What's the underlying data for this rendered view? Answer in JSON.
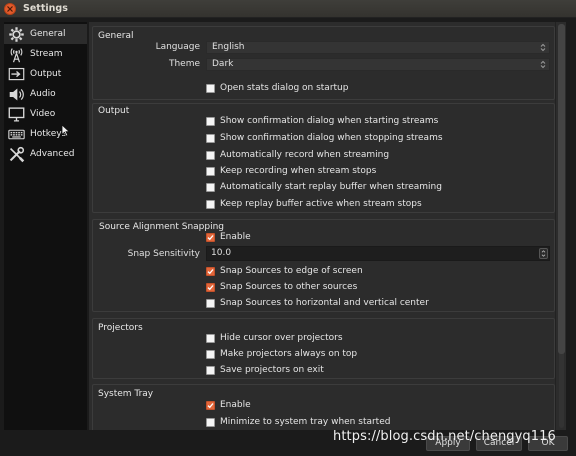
{
  "window": {
    "title": "Settings",
    "close_icon": "close-icon",
    "accent": "#e2663a"
  },
  "sidebar": {
    "items": [
      {
        "label": "General",
        "icon": "gear-icon",
        "active": true
      },
      {
        "label": "Stream",
        "icon": "broadcast-tower-icon"
      },
      {
        "label": "Output",
        "icon": "output-arrow-icon"
      },
      {
        "label": "Audio",
        "icon": "speaker-icon"
      },
      {
        "label": "Video",
        "icon": "monitor-icon"
      },
      {
        "label": "Hotkeys",
        "icon": "keyboard-icon"
      },
      {
        "label": "Advanced",
        "icon": "wrench-screwdriver-icon"
      }
    ]
  },
  "general": {
    "title": "General",
    "language_label": "Language",
    "language_value": "English",
    "theme_label": "Theme",
    "theme_value": "Dark",
    "open_stats": {
      "label": "Open stats dialog on startup",
      "checked": false
    }
  },
  "output": {
    "title": "Output",
    "options": [
      {
        "label": "Show confirmation dialog when starting streams",
        "checked": false
      },
      {
        "label": "Show confirmation dialog when stopping streams",
        "checked": false
      },
      {
        "label": "Automatically record when streaming",
        "checked": false
      },
      {
        "label": "Keep recording when stream stops",
        "checked": false
      },
      {
        "label": "Automatically start replay buffer when streaming",
        "checked": false
      },
      {
        "label": "Keep replay buffer active when stream stops",
        "checked": false
      }
    ]
  },
  "snapping": {
    "title": "Source Alignment Snapping",
    "enable": {
      "label": "Enable",
      "checked": true
    },
    "sensitivity_label": "Snap Sensitivity",
    "sensitivity_value": "10.0",
    "options": [
      {
        "label": "Snap Sources to edge of screen",
        "checked": true
      },
      {
        "label": "Snap Sources to other sources",
        "checked": true
      },
      {
        "label": "Snap Sources to horizontal and vertical center",
        "checked": false
      }
    ]
  },
  "projectors": {
    "title": "Projectors",
    "options": [
      {
        "label": "Hide cursor over projectors",
        "checked": false
      },
      {
        "label": "Make projectors always on top",
        "checked": false
      },
      {
        "label": "Save projectors on exit",
        "checked": false
      }
    ]
  },
  "system_tray": {
    "title": "System Tray",
    "options": [
      {
        "label": "Enable",
        "checked": true
      },
      {
        "label": "Minimize to system tray when started",
        "checked": false
      }
    ]
  },
  "footer": {
    "apply_label": "Apply",
    "cancel_label": "Cancel",
    "ok_label": "OK"
  },
  "watermark": "https://blog.csdn.net/chengyq116"
}
